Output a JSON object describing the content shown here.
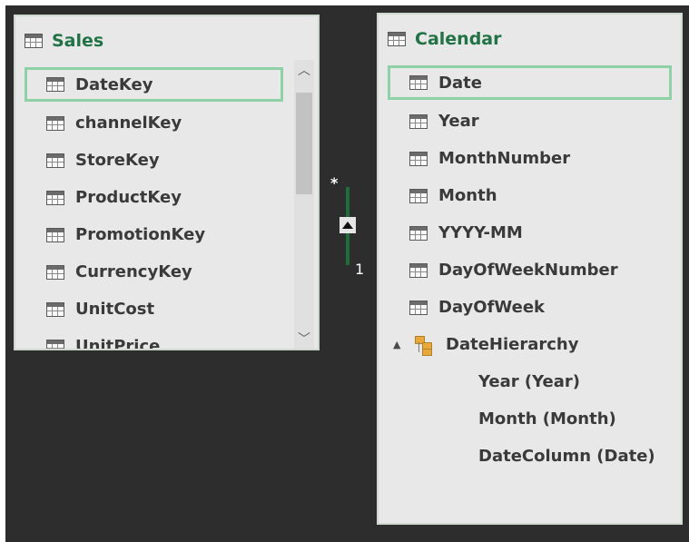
{
  "sales": {
    "title": "Sales",
    "fields": [
      "DateKey",
      "channelKey",
      "StoreKey",
      "ProductKey",
      "PromotionKey",
      "CurrencyKey",
      "UnitCost",
      "UnitPrice"
    ],
    "selected_field": "DateKey"
  },
  "calendar": {
    "title": "Calendar",
    "fields": [
      "Date",
      "Year",
      "MonthNumber",
      "Month",
      "YYYY-MM",
      "DayOfWeekNumber",
      "DayOfWeek"
    ],
    "selected_field": "Date",
    "hierarchy": {
      "name": "DateHierarchy",
      "expanded": true,
      "levels": [
        "Year (Year)",
        "Month (Month)",
        "DateColumn (Date)"
      ]
    }
  },
  "relationship": {
    "from_cardinality": "*",
    "to_cardinality": "1",
    "line_color": "#1f6e3a"
  },
  "icons": {
    "table": "table-icon",
    "hierarchy": "hierarchy-icon",
    "expander": "▲",
    "scroll_up": "︿",
    "scroll_down": "﹀"
  },
  "colors": {
    "title_green": "#217346",
    "selection_border": "#8fd1a6",
    "canvas_background": "#2d2d2d"
  }
}
